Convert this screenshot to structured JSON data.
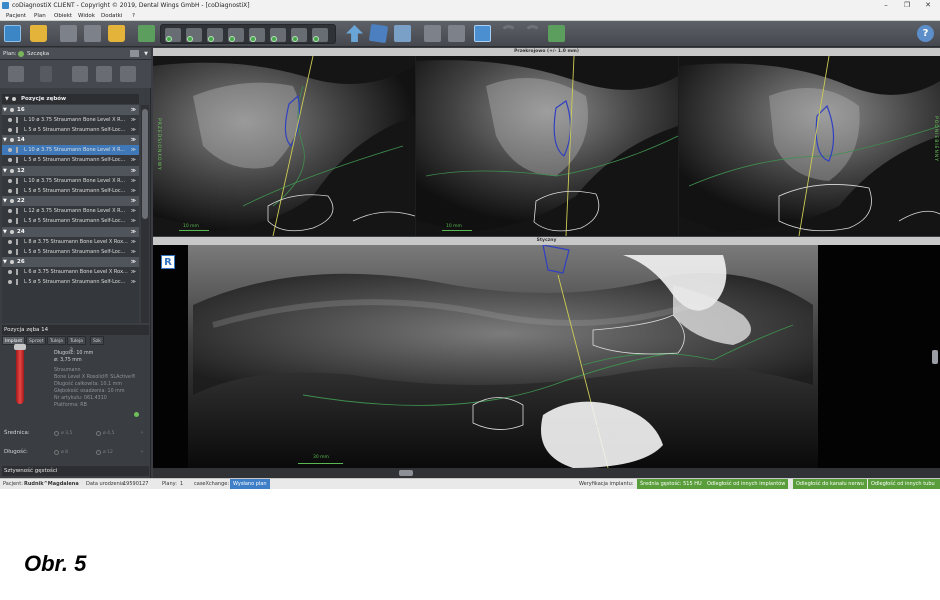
{
  "window": {
    "title": "coDiagnostiX CLIENT - Copyright © 2019, Dental Wings GmbH - [coDiagnostiX]",
    "controls": [
      "–",
      "❐",
      "✕"
    ]
  },
  "menu": [
    "Pacjent",
    "Plan",
    "Obiekt",
    "Widok",
    "Dodatki",
    "?"
  ],
  "left_panel": {
    "plan_label": "Plan:",
    "plan_name": "Szczęka",
    "positions_header": "Pozycje zębów",
    "teeth": [
      {
        "num": "16",
        "rows": [
          {
            "text": "L 10  ø 3.75   Straumann Bone Level X R...",
            "selected": false
          },
          {
            "text": "L 5  ø 5   Straumann Straumann Self-Loc...",
            "selected": false
          }
        ]
      },
      {
        "num": "14",
        "rows": [
          {
            "text": "L 10  ø 3.75   Straumann Bone Level X R...",
            "selected": true
          },
          {
            "text": "L 5  ø 5   Straumann Straumann Self-Loc...",
            "selected": false
          }
        ]
      },
      {
        "num": "12",
        "rows": [
          {
            "text": "L 10  ø 3.75   Straumann Bone Level X R...",
            "selected": false
          },
          {
            "text": "L 5  ø 5   Straumann Straumann Self-Loc...",
            "selected": false
          }
        ]
      },
      {
        "num": "22",
        "rows": [
          {
            "text": "L 12  ø 3.75   Straumann Bone Level X R...",
            "selected": false
          },
          {
            "text": "L 5  ø 5   Straumann Straumann Self-Loc...",
            "selected": false
          }
        ]
      },
      {
        "num": "24",
        "rows": [
          {
            "text": "L 8  ø 3.75   Straumann Bone Level X Rox...",
            "selected": false
          },
          {
            "text": "L 5  ø 5   Straumann Straumann Self-Loc...",
            "selected": false
          }
        ]
      },
      {
        "num": "26",
        "rows": [
          {
            "text": "L 6  ø 3.75   Straumann Bone Level X Rox...",
            "selected": false
          },
          {
            "text": "L 5  ø 5   Straumann Straumann Self-Loc...",
            "selected": false
          }
        ]
      }
    ],
    "position_section": "Pozycja zęba 14",
    "tabs": [
      "Implant",
      "Sprzęt",
      "Tuleja",
      "Tuleja 2",
      "Szk"
    ],
    "implant": {
      "length": "Długość: 10 mm",
      "diameter": "ø: 3,75 mm",
      "maker": "Straumann",
      "model": "Bone Level X Roxolid® SLActive®",
      "total_length": "Długość całkowita: 10,1 mm",
      "depth": "Głębokość osadzenia: 10 mm",
      "catalog": "Nr artykułu: 061.4310",
      "platform": "Platforma: RB"
    },
    "diameter_label": "Średnica:",
    "length_label": "Długość:",
    "option_values": [
      "ø 3,5",
      "ø 4,5",
      "ø 8",
      "ø 12"
    ],
    "density_section": "Sztywność gęstości"
  },
  "views": {
    "top_title": "Przekrojowo (+/- 1.0 mm)",
    "bottom_title": "Styczny",
    "scale_top": "10 mm",
    "scale_bottom": "30 mm",
    "side_left": "PRZEDSIONKOWY",
    "side_right": "PODNIEBIENNY",
    "badge": "R"
  },
  "statusbar": {
    "patient_label": "Pacjent:",
    "patient": "Rudnik^Magdalena",
    "birth_label": "Data urodzenia:",
    "birth": "19590127",
    "plans_label": "Plany:",
    "plans": "1",
    "case_label": "caseXchange:",
    "case_value": "Wysłano plan",
    "verify_label": "Weryfikacja implantu:",
    "checks": [
      "Średnia gęstość: 515 HU",
      "Odległość od innych implantów",
      "Odległość do kanału nerwu",
      "Odległość od innych tubu"
    ]
  },
  "caption": "Obr. 5",
  "colors": {
    "toolbar": "#4f5359",
    "selection": "#3f78b8",
    "ok_green": "#5a9e3c",
    "accent_blue": "#3f7fc8"
  }
}
